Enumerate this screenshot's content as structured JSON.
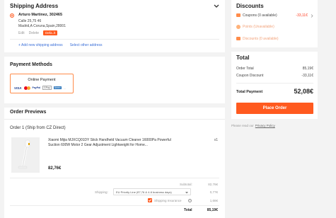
{
  "shipping": {
    "title": "Shipping Address",
    "name": "Arturo Martinez, 302465",
    "street": "Calle 25,75 46",
    "city": "Madrid,A Coruna,Spain,28001",
    "edit": "Edit",
    "delete": "Delete",
    "default_badge": "Defa..lt",
    "add_new": "+ Add new shipping address",
    "select_other": "Select other address"
  },
  "payment": {
    "title": "Payment Methods",
    "option_label": "Online Payment",
    "logos": [
      "VISA",
      "MC",
      "PayPal",
      "GPay",
      "Amex",
      "..."
    ]
  },
  "order": {
    "title": "Order Previews",
    "group_label": "Order 1 (Ship from CZ Direct)",
    "product_title": "Xiaomi Mijia MJXCQ01DY Stick Handheld Vacuum Cleaner 16000Pa Powerful Suction 600W Motor 2 Gear Adjustment Lightweight for Home...",
    "qty": "x1",
    "price": "82,76€",
    "subtotal_label": "Subtotal:",
    "subtotal_value": "82,76€",
    "shipping_label": "Shipping:",
    "shipping_option": "EU Priority Line (€7,76 & 4-6 business days)",
    "shipping_value": "0,77€",
    "insurance_label": "Shipping Insurance",
    "insurance_value": "1,66€",
    "total_label": "Total",
    "total_value": "85,19€"
  },
  "discounts": {
    "title": "Discounts",
    "coupons_label": "Coupons (0 available)",
    "coupons_value": "-33,11€",
    "points_label": "Points (Unavailable)",
    "vouchers_label": "Discounts (0 available)"
  },
  "total": {
    "title": "Total",
    "order_total_label": "Order Total",
    "order_total_value": "85,19€",
    "coupon_discount_label": "Coupon Discount",
    "coupon_discount_value": "-33,11€",
    "payment_label": "Total Payment",
    "payment_value": "52,08€",
    "place_order": "Place Order",
    "policy_prefix": "Please read our",
    "policy_link": "Privacy Policy"
  },
  "colors": {
    "accent": "#ff5a1f",
    "link": "#3b6fd8"
  }
}
